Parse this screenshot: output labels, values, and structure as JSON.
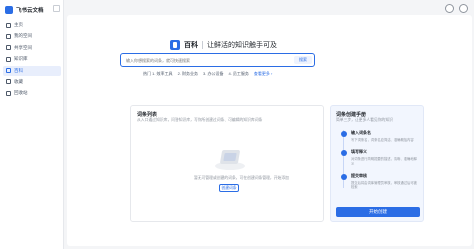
{
  "app": {
    "name": "飞书云文档"
  },
  "sidebar": {
    "items": [
      {
        "label": "主页",
        "active": false,
        "icon": "home-icon"
      },
      {
        "label": "我的空间",
        "active": false,
        "icon": "folder-icon"
      },
      {
        "label": "共享空间",
        "active": false,
        "icon": "share-icon"
      },
      {
        "label": "知识库",
        "active": false,
        "icon": "book-icon"
      },
      {
        "label": "百科",
        "active": true,
        "icon": "encyclopedia-icon"
      },
      {
        "label": "收藏",
        "active": false,
        "icon": "star-icon"
      },
      {
        "label": "回收站",
        "active": false,
        "icon": "trash-icon"
      }
    ]
  },
  "header": {
    "product_name": "百科",
    "slogan": "让鲜活的知识触手可及"
  },
  "search": {
    "placeholder": "输入你想搜索的词条，就可快速搜索",
    "button_label": "搜索"
  },
  "quick_links": [
    {
      "label": "热门 1. 效率工具"
    },
    {
      "label": "2. 财务业务"
    },
    {
      "label": "3. 办公设备"
    },
    {
      "label": "4. 员工服务"
    },
    {
      "label": "查看更多 ›",
      "more": true
    }
  ],
  "my_entries": {
    "title": "词条列表",
    "description": "从入口通过知识库，问答知识库，写你所创建过词条、可编辑的知识库词条",
    "empty_text": "暂无可管理或创建的词条，可在创建词条管理，开始添加",
    "create_button": "创建词条"
  },
  "guide": {
    "title": "词条创建手册",
    "description": "简单三步，让更多人看见你的知识",
    "steps": [
      {
        "title": "输入词条名",
        "desc": "写下词条名，词条名应简洁、准确概括内容"
      },
      {
        "title": "填写释义",
        "desc": "对词条进行简明扼要的描述，清晰、准确地释义"
      },
      {
        "title": "提交审核",
        "desc": "提交后将由词库管理员审核，审核通过后可被检索"
      }
    ],
    "start_button": "开始创建"
  },
  "colors": {
    "accent": "#2b6de5",
    "sidebar_active_bg": "#e8eefc"
  }
}
